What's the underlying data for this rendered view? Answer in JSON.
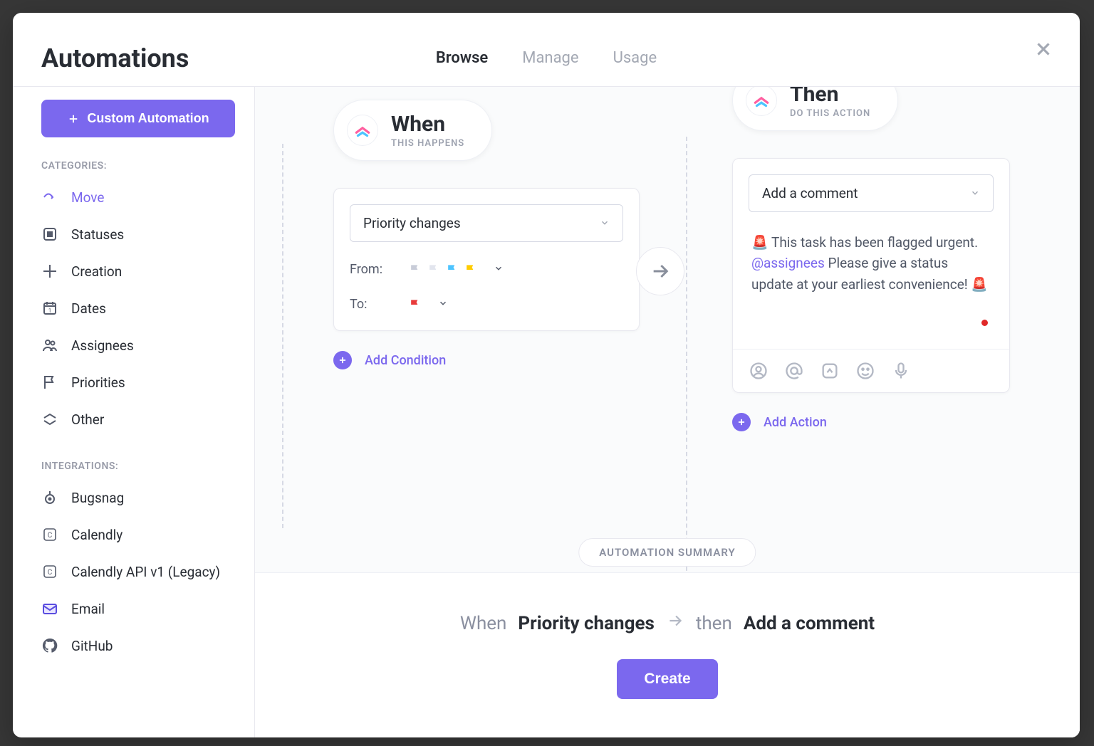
{
  "header": {
    "title": "Automations",
    "tabs": [
      "Browse",
      "Manage",
      "Usage"
    ]
  },
  "sidebar": {
    "custom_button": "Custom Automation",
    "categories_label": "CATEGORIES:",
    "categories": [
      "Move",
      "Statuses",
      "Creation",
      "Dates",
      "Assignees",
      "Priorities",
      "Other"
    ],
    "integrations_label": "INTEGRATIONS:",
    "integrations": [
      "Bugsnag",
      "Calendly",
      "Calendly API v1 (Legacy)",
      "Email",
      "GitHub"
    ]
  },
  "when": {
    "title": "When",
    "sub": "THIS HAPPENS",
    "trigger": "Priority changes",
    "from_label": "From:",
    "to_label": "To:",
    "add_condition": "Add Condition"
  },
  "then": {
    "title": "Then",
    "sub": "DO THIS ACTION",
    "action": "Add a comment",
    "comment_leading": "🚨 This task has been flagged urgent. ",
    "comment_mention": "@assignees",
    "comment_trailing": " Please give a status update at your earliest convenience! 🚨",
    "add_action": "Add Action"
  },
  "summary": {
    "pill": "AUTOMATION SUMMARY",
    "when_word": "When",
    "when_value": "Priority changes",
    "then_word": "then",
    "then_value": "Add a comment",
    "create": "Create"
  }
}
